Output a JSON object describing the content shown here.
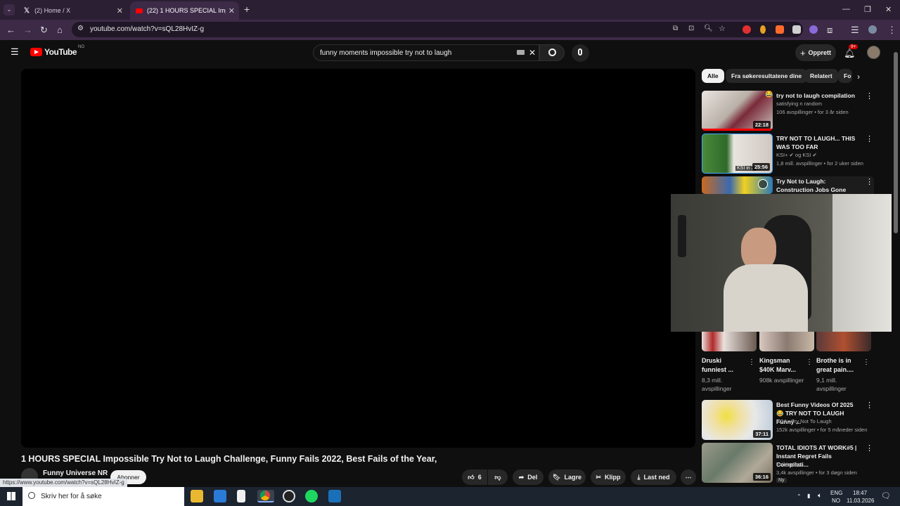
{
  "browser": {
    "tabs": [
      {
        "title": "(2) Home / X",
        "icon": "x-logo-icon"
      },
      {
        "title": "(22) 1 HOURS SPECIAL Impossi",
        "icon": "youtube-favicon"
      }
    ],
    "url": "youtube.com/watch?v=sQL28HvIZ-g",
    "status_url": "https://www.youtube.com/watch?v=sQL28HvIZ-g"
  },
  "youtube": {
    "logo_text": "YouTube",
    "region": "NO",
    "search_query": "funny moments impossible try not to laugh",
    "create_label": "Opprett",
    "notifications_badge": "9+"
  },
  "video": {
    "title": "1 HOURS SPECIAL Impossible Try Not to Laugh Challenge, Funny Fails 2022, Best Fails of the Year,",
    "channel": "Funny Universe NR",
    "subscribe_label": "Abonner",
    "likes": "6",
    "share_label": "Del",
    "save_label": "Lagre",
    "clip_label": "Klipp",
    "download_label": "Last ned"
  },
  "chips": [
    "Alle",
    "Fra søkeresultatene dine",
    "Relatert",
    "Fo"
  ],
  "recommendations": [
    {
      "title": "try not to laugh compilation",
      "channel": "satisfying n random",
      "meta": "106 avspillinger • for 3 år siden",
      "duration": "22:18"
    },
    {
      "title": "TRY NOT TO LAUGH... THIS WAS TOO FAR",
      "channel": "KSI+ ✔ og KSI ✔",
      "meta": "1,8 mill. avspillinger • for 2 uker siden",
      "duration": "25:56",
      "thumb_text": "KSI in 2"
    },
    {
      "title": "Try Not to Laugh: Construction Jobs Gone Hilariously Wrong!",
      "channel": "",
      "meta": "",
      "duration": ""
    },
    {
      "title": "Best Funny Videos Of 2025 😂 TRY NOT TO LAUGH Funny ...",
      "channel": "ACA - Try Not To Laugh",
      "meta": "152k avspillinger • for 5 måneder siden",
      "duration": "37:11"
    },
    {
      "title": "TOTAL IDIOTS AT WORK#5 | Instant Regret Fails Compilati...",
      "channel": "Fail Impact",
      "meta": "3,4k avspillinger • for 3 døgn siden",
      "duration": "36:16",
      "badge": "Ny"
    }
  ],
  "shorts": [
    {
      "title": "Druski funniest ...",
      "meta": "8,3 mill. avspillinger"
    },
    {
      "title": "Kingsman $40K Marv...",
      "meta": "908k avspillinger"
    },
    {
      "title": "Brothe is in great pain....",
      "meta": "9,1 mill. avspillinger"
    }
  ],
  "taskbar": {
    "search_placeholder": "Skriv her for å søke",
    "lang_top": "ENG",
    "lang_bottom": "NO",
    "time": "18:47",
    "date": "11.03.2026"
  },
  "colors": {
    "youtube_red": "#ff0000",
    "browser_frame": "#2b1f33",
    "page_bg": "#0f0f0f"
  }
}
